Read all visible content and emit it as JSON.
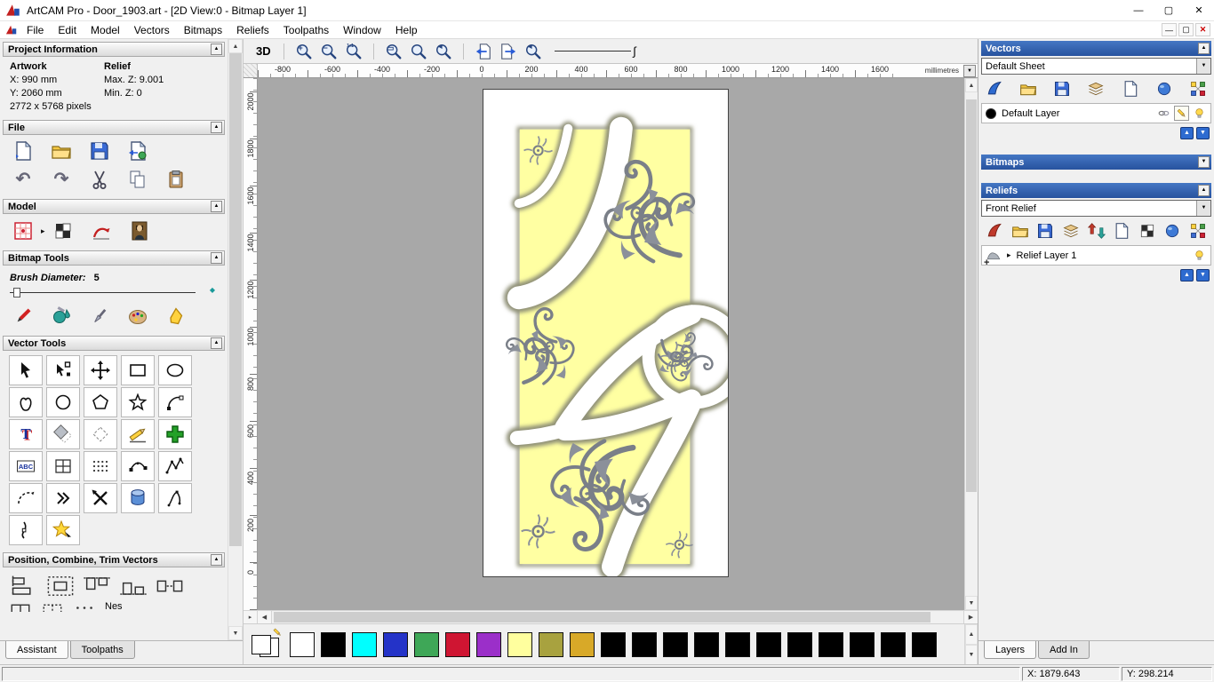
{
  "window": {
    "title": "ArtCAM Pro - Door_1903.art - [2D View:0 - Bitmap Layer 1]",
    "caption": {
      "minimize": "—",
      "maximize": "▢",
      "close": "✕"
    }
  },
  "menu": {
    "items": [
      "File",
      "Edit",
      "Model",
      "Vectors",
      "Bitmaps",
      "Reliefs",
      "Toolpaths",
      "Window",
      "Help"
    ]
  },
  "assistant": {
    "project": {
      "title": "Project Information",
      "artwork": "Artwork",
      "relief": "Relief",
      "x": "X: 990 mm",
      "y": "Y: 2060 mm",
      "maxz": "Max. Z: 9.001",
      "minz": "Min. Z: 0",
      "pixels": "2772 x 5768 pixels"
    },
    "sections": {
      "file": "File",
      "model": "Model",
      "bitmap": "Bitmap Tools",
      "vector": "Vector Tools",
      "position": "Position, Combine, Trim Vectors"
    },
    "brush": {
      "label": "Brush Diameter:",
      "value": "5"
    },
    "nesting": "Nes",
    "tabs": [
      "Assistant",
      "Toolpaths"
    ]
  },
  "toolbar": {
    "view3d": "3D"
  },
  "rulers": {
    "top": [
      "-800",
      "-600",
      "-400",
      "-200",
      "0",
      "200",
      "400",
      "600",
      "800",
      "1000",
      "1200",
      "1400",
      "1600"
    ],
    "left": [
      "2000",
      "1800",
      "1600",
      "1400",
      "1200",
      "1000",
      "800",
      "600",
      "400",
      "200",
      "0"
    ],
    "units": "millimetres"
  },
  "panels": {
    "vectors": {
      "title": "Vectors",
      "sheet": "Default Sheet",
      "layer": "Default Layer"
    },
    "bitmaps": {
      "title": "Bitmaps"
    },
    "reliefs": {
      "title": "Reliefs",
      "relief": "Front Relief",
      "layer": "Relief Layer 1"
    },
    "tabs": [
      "Layers",
      "Add In"
    ]
  },
  "palette": {
    "colors": [
      "#ffffff",
      "#000000",
      "#00ffff",
      "#2433c8",
      "#3ea757",
      "#cf1532",
      "#9b2fc9",
      "#ffff9e",
      "#a8a23f",
      "#d8a928",
      "#000000",
      "#000000",
      "#000000",
      "#000000",
      "#000000",
      "#000000",
      "#000000",
      "#000000",
      "#000000",
      "#000000",
      "#000000"
    ]
  },
  "status": {
    "x": "X: 1879.643",
    "y": "Y: 298.214"
  },
  "icons": {
    "collapse": "▲",
    "expand": "▼",
    "up": "▲",
    "down": "▼",
    "left": "◀",
    "right": "▶",
    "small_right": "▸",
    "plus": "+",
    "minus": "−",
    "one2one": "1:1",
    "rect": "▭",
    "undo": "↶",
    "redo": "↷",
    "diamond": "◆",
    "plus_mini": "+"
  },
  "colors": {
    "header_blue": "#2e5fae",
    "artwork_yellow": "#ffffa2",
    "canvas_gray": "#a8a8a8"
  }
}
